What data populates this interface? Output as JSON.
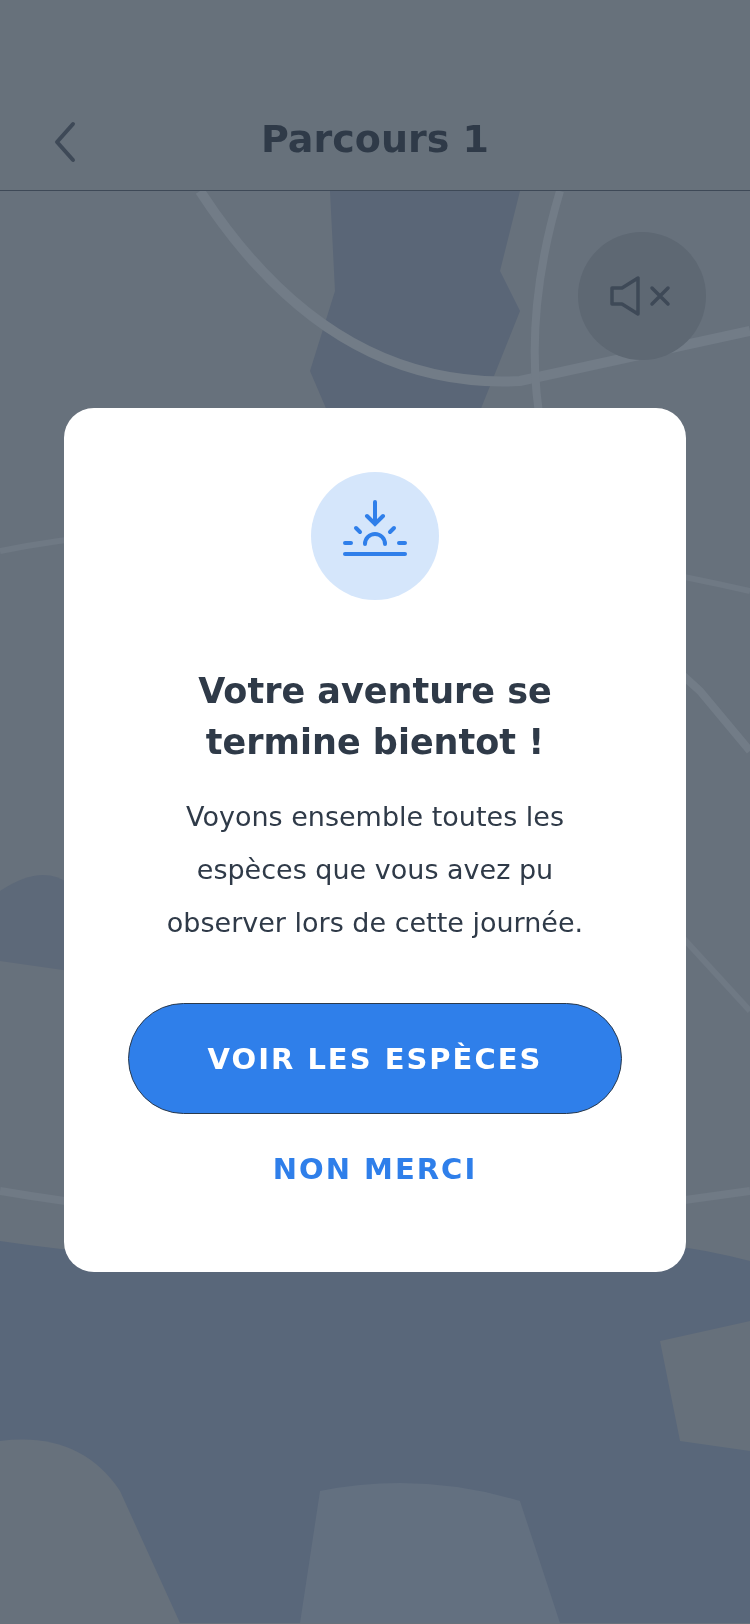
{
  "header": {
    "title": "Parcours 1"
  },
  "dialog": {
    "title": "Votre aventure se termine bientot !",
    "message": "Voyons ensemble toutes les espèces que vous avez pu observer lors de cette journée.",
    "primary_button": "VOIR LES ESPÈCES",
    "secondary_button": "NON MERCI"
  }
}
